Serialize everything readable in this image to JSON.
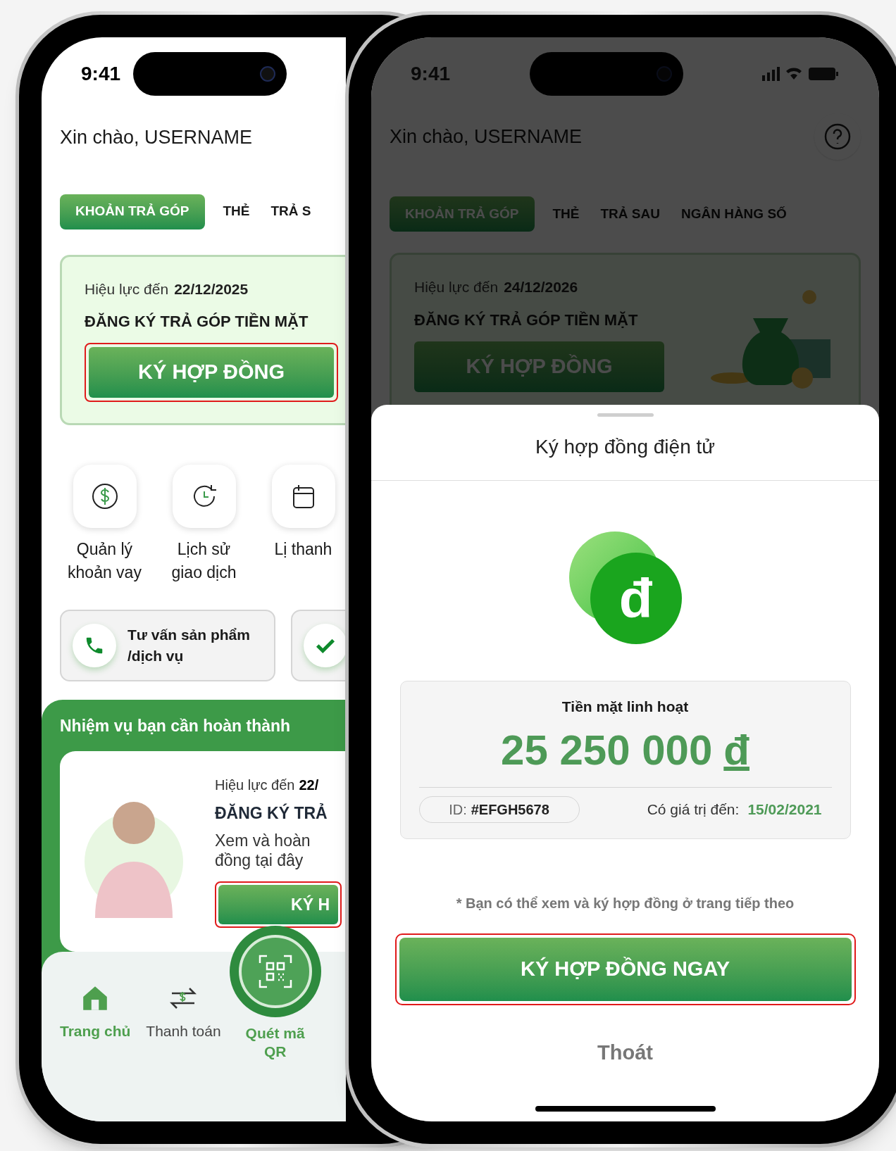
{
  "home_screen": {
    "status_time": "9:41",
    "greeting": "Xin chào, USERNAME",
    "tabs": [
      {
        "label": "KHOẢN TRẢ GÓP",
        "selected": true
      },
      {
        "label": "THẺ",
        "selected": false
      },
      {
        "label": "TRẢ S",
        "selected": false
      }
    ],
    "offer": {
      "validity_label": "Hiệu lực đến",
      "validity_date": "22/12/2025",
      "title": "ĐĂNG KÝ TRẢ GÓP TIỀN MẶT",
      "button": "KÝ HỢP ĐỒNG"
    },
    "shortcuts": [
      {
        "label": "Quản lý khoản vay",
        "kind": "dollar"
      },
      {
        "label": "Lịch sử giao dịch",
        "kind": "history"
      },
      {
        "label": "Lị thanh",
        "kind": "calendar"
      }
    ],
    "services": [
      {
        "label": "Tư vấn sản phẩm /dịch vụ",
        "kind": "phone"
      },
      {
        "kind": "check"
      }
    ],
    "tasks": {
      "title": "Nhiệm vụ bạn cần hoàn thành",
      "validity_label": "Hiệu lực đến",
      "validity_date": "22/",
      "title_card": "ĐĂNG KÝ TRẢ",
      "description": [
        "Xem và hoàn",
        "đồng tại đây"
      ],
      "button": "KÝ H"
    },
    "nav": [
      {
        "label": "Trang chủ",
        "kind": "home",
        "selected": true
      },
      {
        "label": "Thanh toán",
        "kind": "transfer",
        "selected": false
      },
      {
        "label": "Quét mã QR",
        "kind": "qr",
        "selected": true
      }
    ]
  },
  "contract_screen": {
    "status_time": "9:41",
    "greeting": "Xin chào, USERNAME",
    "tabs": [
      {
        "label": "KHOẢN TRẢ GÓP",
        "selected": true
      },
      {
        "label": "THẺ",
        "selected": false
      },
      {
        "label": "TRẢ SAU",
        "selected": false
      },
      {
        "label": "NGÂN HÀNG SỐ",
        "selected": false
      }
    ],
    "offer": {
      "validity_label": "Hiệu lực đến",
      "validity_date": "24/12/2026",
      "title": "ĐĂNG KÝ TRẢ GÓP TIỀN MẶT",
      "button": "KÝ HỢP ĐỒNG"
    },
    "sheet": {
      "title": "Ký hợp đồng điện tử",
      "logo_letter": "đ",
      "amount_label": "Tiền mặt linh hoạt",
      "amount": "25 250 000",
      "currency": "đ",
      "id_label": "ID:",
      "id_value": "#EFGH5678",
      "valid_label": "Có giá trị đến:",
      "valid_date": "15/02/2021",
      "note": "* Bạn có thể xem và ký hợp đồng ở trang tiếp theo",
      "button": "KÝ HỢP ĐỒNG NGAY",
      "exit": "Thoát"
    }
  }
}
